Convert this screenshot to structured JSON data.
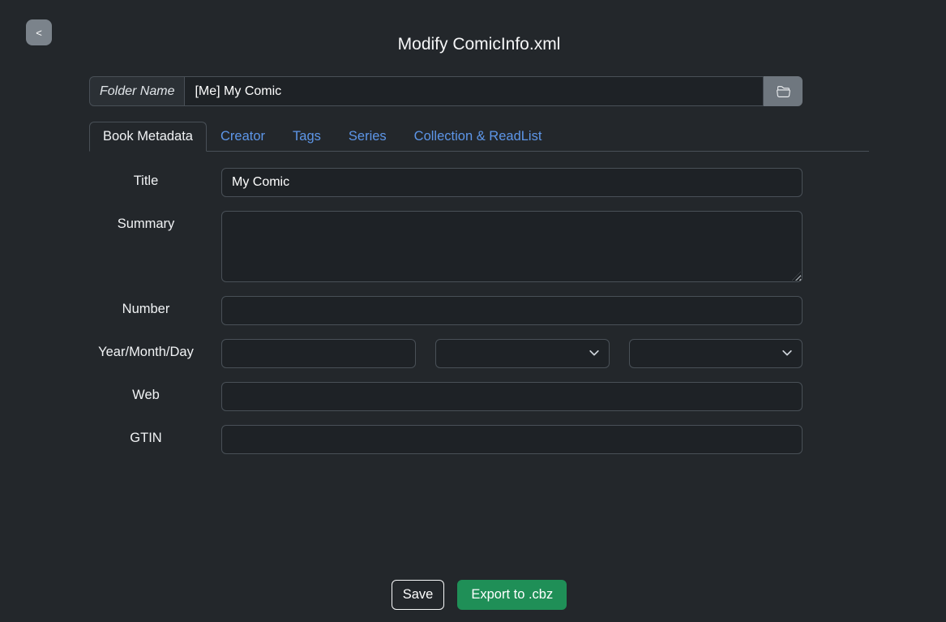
{
  "page": {
    "title": "Modify ComicInfo.xml"
  },
  "back_button": {
    "label": "<"
  },
  "folder": {
    "label": "Folder Name",
    "value": "[Me] My Comic",
    "browse_icon": "folder-open-icon"
  },
  "tabs": [
    {
      "label": "Book Metadata",
      "active": true
    },
    {
      "label": "Creator",
      "active": false
    },
    {
      "label": "Tags",
      "active": false
    },
    {
      "label": "Series",
      "active": false
    },
    {
      "label": "Collection & ReadList",
      "active": false
    }
  ],
  "form": {
    "fields": [
      {
        "label": "Title",
        "type": "text",
        "value": "My Comic"
      },
      {
        "label": "Summary",
        "type": "textarea",
        "value": ""
      },
      {
        "label": "Number",
        "type": "text",
        "value": ""
      },
      {
        "label": "Year/Month/Day",
        "type": "date-triple",
        "year": "",
        "month": "",
        "day": ""
      },
      {
        "label": "Web",
        "type": "text",
        "value": ""
      },
      {
        "label": "GTIN",
        "type": "text",
        "value": ""
      }
    ]
  },
  "actions": {
    "save_label": "Save",
    "export_label": "Export to .cbz"
  },
  "colors": {
    "background": "#23272b",
    "input_background": "#1e2226",
    "border": "#495057",
    "tab_link": "#5d96e8",
    "export_green": "#1f8f57",
    "back_button_gray": "#7b838b"
  }
}
